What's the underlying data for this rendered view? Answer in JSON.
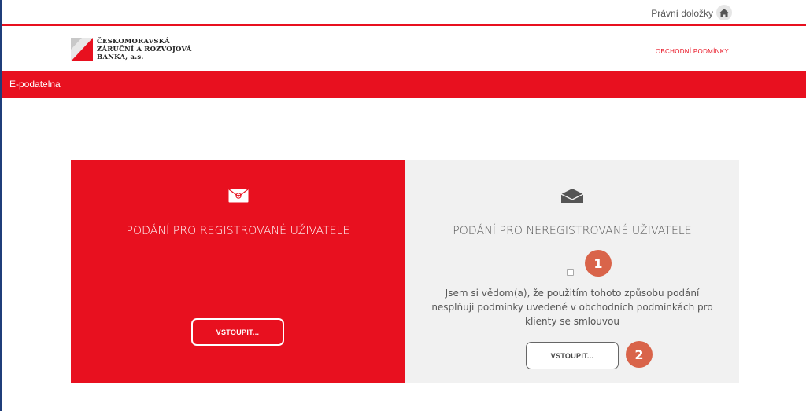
{
  "topbar": {
    "legal_link": "Právní doložky",
    "home_icon": "home-icon"
  },
  "header": {
    "logo_lines": [
      "ČESKOMORAVSKÁ",
      "ZÁRUČNÍ A ROZVOJOVÁ",
      "BANKA, a.s."
    ],
    "terms_link": "OBCHODNÍ PODMÍNKY"
  },
  "nav": {
    "item": "E-podatelna"
  },
  "panels": {
    "registered": {
      "icon": "email-at-icon",
      "title": "PODÁNÍ PRO REGISTROVANÉ UŽIVATELE",
      "button": "VSTOUPIT..."
    },
    "unregistered": {
      "icon": "envelope-icon",
      "title": "PODÁNÍ PRO NEREGISTROVANÉ UŽIVATELE",
      "agreement": "Jsem si vědom(a), že použitím tohoto způsobu podání nesplňuji podmínky uvedené v obchodních podmínkách pro klienty se smlouvou",
      "button": "VSTOUPIT...",
      "checkbox_checked": false
    }
  },
  "annotations": {
    "badge1": "1",
    "badge2": "2"
  },
  "colors": {
    "brand_red": "#e8101f",
    "badge": "#d9644a",
    "panel_gray": "#f1f1f1"
  }
}
